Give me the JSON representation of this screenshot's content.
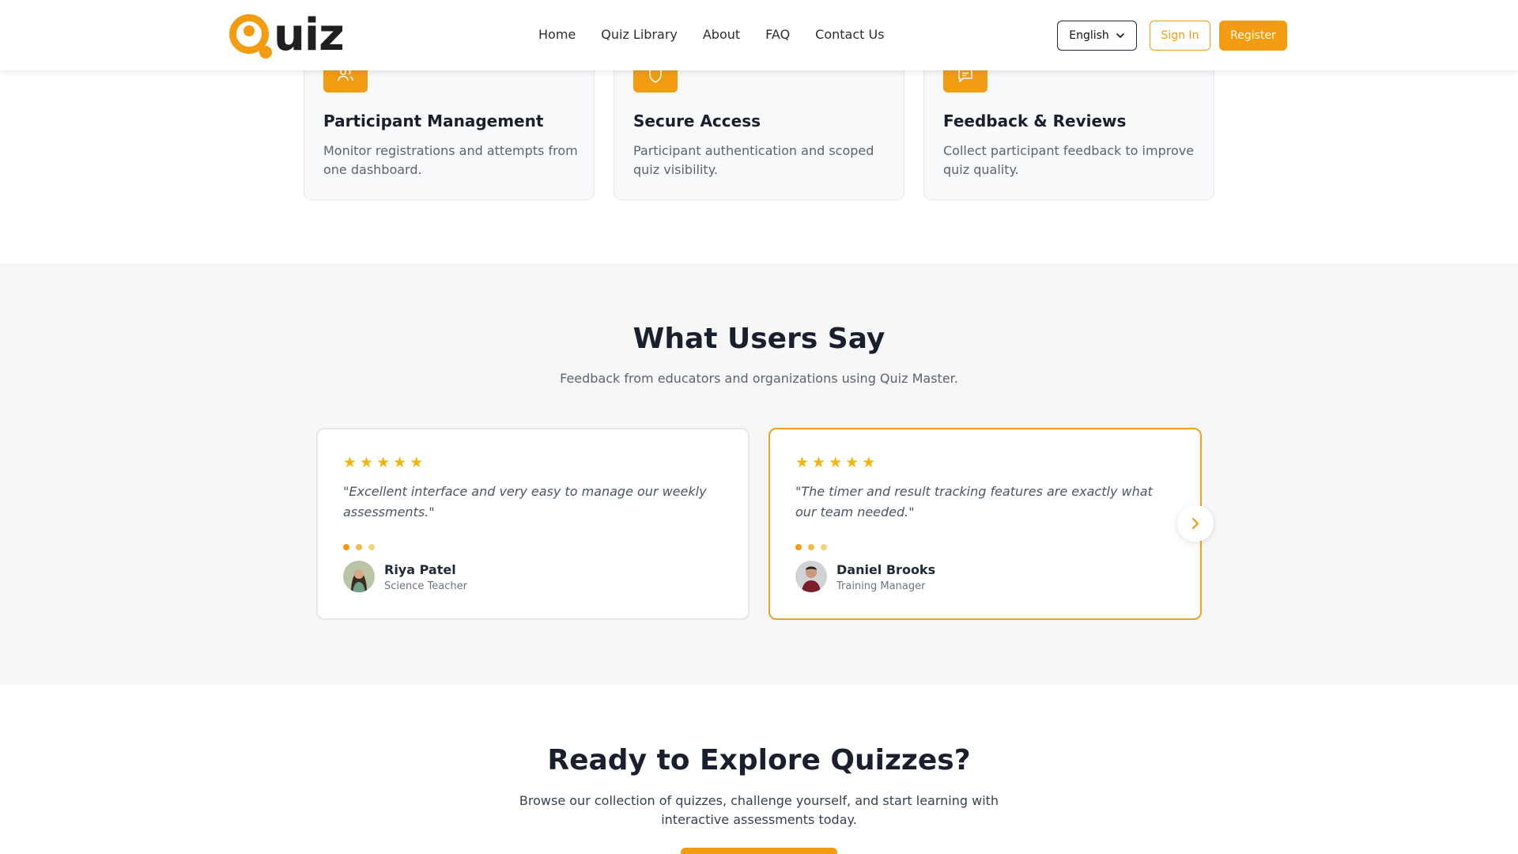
{
  "header": {
    "logo_text": "uiz",
    "nav": [
      "Home",
      "Quiz Library",
      "About",
      "FAQ",
      "Contact Us"
    ],
    "language": "English",
    "signin_label": "Sign In",
    "register_label": "Register"
  },
  "features": [
    {
      "title": "Participant Management",
      "desc": "Monitor registrations and attempts from one dashboard.",
      "icon": "users-icon"
    },
    {
      "title": "Secure Access",
      "desc": "Participant authentication and scoped quiz visibility.",
      "icon": "shield-icon"
    },
    {
      "title": "Feedback & Reviews",
      "desc": "Collect participant feedback to improve quiz quality.",
      "icon": "message-icon"
    }
  ],
  "testimonials": {
    "title": "What Users Say",
    "subtitle": "Feedback from educators and organizations using Quiz Master.",
    "items": [
      {
        "rating": 5,
        "quote": "\"Excellent interface and very easy to manage our weekly assessments.\"",
        "name": "Riya Patel",
        "role": "Science Teacher"
      },
      {
        "rating": 5,
        "quote": "\"The timer and result tracking features are exactly what our team needed.\"",
        "name": "Daniel Brooks",
        "role": "Training Manager"
      }
    ]
  },
  "cta": {
    "title": "Ready to Explore Quizzes?",
    "subtitle": "Browse our collection of quizzes, challenge yourself, and start learning with interactive assessments today."
  },
  "colors": {
    "accent": "#f39c12",
    "star": "#f5b50a",
    "active_border": "#f0a21f"
  }
}
